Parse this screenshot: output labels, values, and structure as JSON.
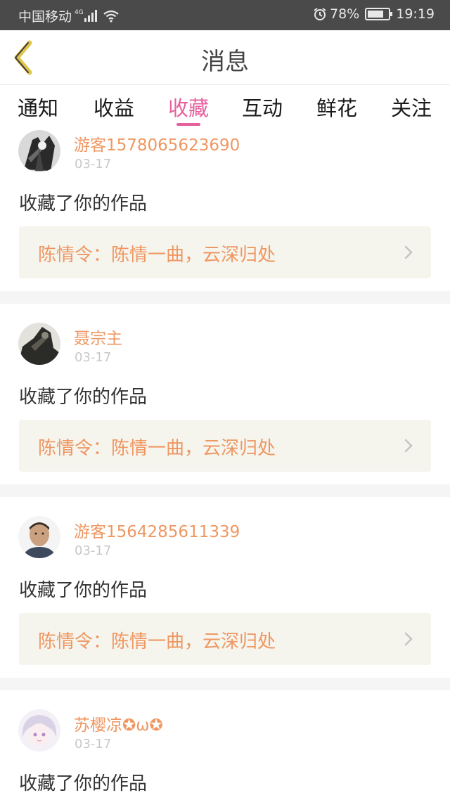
{
  "status_bar": {
    "carrier": "中国移动",
    "network": "4G",
    "battery_percent": "78%",
    "battery_level": 0.78,
    "time": "19:19"
  },
  "header": {
    "title": "消息",
    "back_icon": "chevron-left-icon"
  },
  "tabs": [
    {
      "label": "通知",
      "active": false
    },
    {
      "label": "收益",
      "active": false
    },
    {
      "label": "收藏",
      "active": true
    },
    {
      "label": "互动",
      "active": false
    },
    {
      "label": "鲜花",
      "active": false
    },
    {
      "label": "关注",
      "active": false
    }
  ],
  "messages": [
    {
      "user": "游客1578065623690",
      "date": "03-17",
      "text": "收藏了你的作品",
      "work": "陈情令：陈情一曲，云深归处"
    },
    {
      "user": "聂宗主",
      "date": "03-17",
      "text": "收藏了你的作品",
      "work": "陈情令：陈情一曲，云深归处"
    },
    {
      "user": "游客1564285611339",
      "date": "03-17",
      "text": "收藏了你的作品",
      "work": "陈情令：陈情一曲，云深归处"
    },
    {
      "user": "苏樱凉✪ω✪",
      "date": "03-17",
      "text": "收藏了你的作品"
    }
  ],
  "colors": {
    "accent": "#e6609e",
    "name": "#ef9762",
    "status_bar": "#4a4a4a"
  }
}
